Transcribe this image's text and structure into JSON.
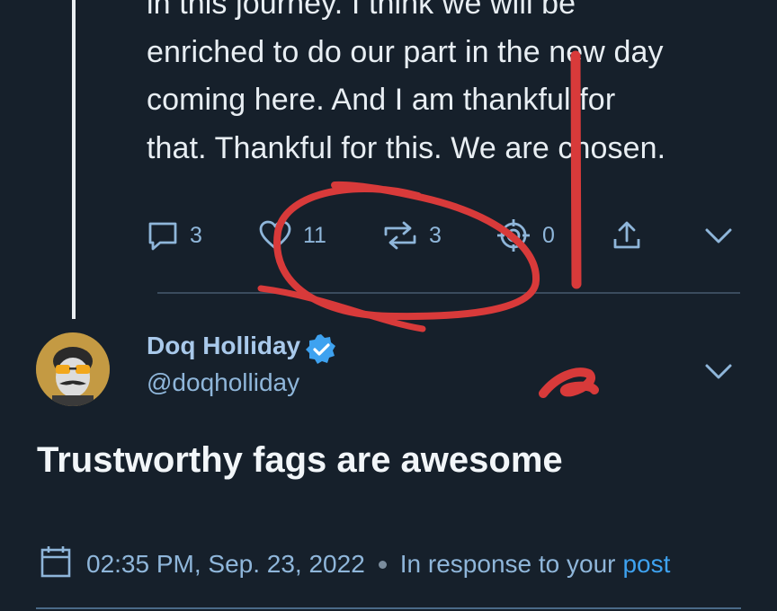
{
  "parent_tweet": {
    "lines": [
      "in this journey. I think we will be",
      "enriched to do our part in the new day",
      "coming here. And I am thankful for",
      "that. Thankful for this. We are chosen."
    ],
    "actions": {
      "comments": "3",
      "likes": "11",
      "reposts": "3",
      "target_count": "0"
    }
  },
  "reply": {
    "author_name": "Doq Holliday",
    "author_handle": "@doqholliday",
    "text": "Trustworthy fags are awesome",
    "timestamp": "02:35 PM, Sep. 23, 2022",
    "response_prefix": "In response to your",
    "response_link": "post"
  },
  "colors": {
    "background": "#16202b",
    "link": "#3ea2f0",
    "muted": "#8fb6da",
    "annotation": "#d83a3a"
  },
  "icons": [
    "comment-icon",
    "heart-icon",
    "repost-icon",
    "target-icon",
    "share-icon",
    "chevron-down-icon",
    "verified-icon",
    "calendar-icon"
  ]
}
